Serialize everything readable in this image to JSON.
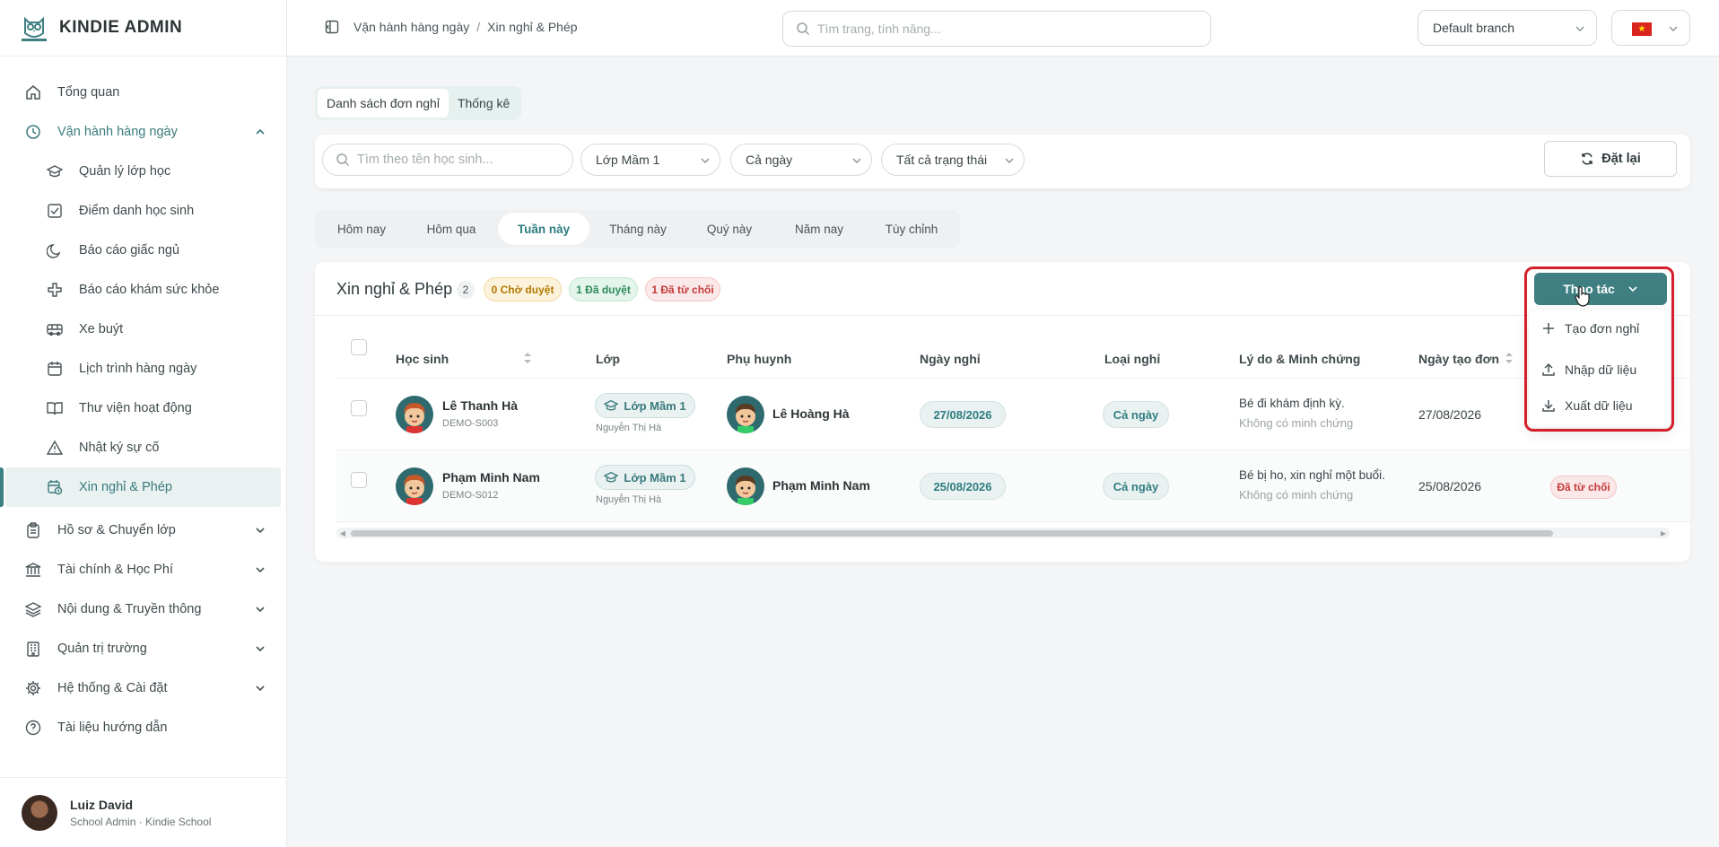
{
  "brand": {
    "name": "KINDIE ADMIN"
  },
  "sidebar": {
    "items": [
      {
        "label": "Tổng quan"
      },
      {
        "label": "Vận hành hàng ngày"
      },
      {
        "label": "Quản lý lớp học"
      },
      {
        "label": "Điểm danh học sinh"
      },
      {
        "label": "Báo cáo giấc ngủ"
      },
      {
        "label": "Báo cáo khám sức khỏe"
      },
      {
        "label": "Xe buýt"
      },
      {
        "label": "Lịch trình hàng ngày"
      },
      {
        "label": "Thư viện hoạt động"
      },
      {
        "label": "Nhật ký sự cố"
      },
      {
        "label": "Xin nghỉ & Phép"
      },
      {
        "label": "Hồ sơ & Chuyển lớp"
      },
      {
        "label": "Tài chính & Học Phí"
      },
      {
        "label": "Nội dung & Truyền thông"
      },
      {
        "label": "Quản trị trường"
      },
      {
        "label": "Hệ thống & Cài đặt"
      },
      {
        "label": "Tài liệu hướng dẫn"
      }
    ]
  },
  "user": {
    "name": "Luiz David",
    "role": "School Admin · Kindie School"
  },
  "topbar": {
    "breadcrumb": [
      "Vận hành hàng ngày",
      "/",
      "Xin nghỉ & Phép"
    ],
    "search_placeholder": "Tìm trang, tính năng...",
    "branch": "Default branch",
    "flag_star": "★"
  },
  "tabs": [
    "Danh sách đơn nghỉ",
    "Thống kê"
  ],
  "filters": {
    "search_placeholder": "Tìm theo tên học sinh...",
    "class": "Lớp Mầm 1",
    "day": "Cả ngày",
    "status": "Tất cả trạng thái",
    "reset": "Đặt lại"
  },
  "periods": [
    "Hôm nay",
    "Hôm qua",
    "Tuần này",
    "Tháng này",
    "Quý này",
    "Năm nay",
    "Tùy chỉnh"
  ],
  "card": {
    "title": "Xin nghỉ & Phép",
    "count": "2",
    "pending": "0 Chờ duyệt",
    "approved": "1 Đã duyệt",
    "rejected": "1 Đã từ chối"
  },
  "table": {
    "headers": [
      "Học sinh",
      "Lớp",
      "Phụ huynh",
      "Ngày nghỉ",
      "Loại nghỉ",
      "Lý do & Minh chứng",
      "Ngày tạo đơn"
    ],
    "rows": [
      {
        "student": "Lê Thanh Hà",
        "code": "DEMO-S003",
        "class": "Lớp Mầm 1",
        "teacher": "Nguyễn Thị Hà",
        "parent": "Lê Hoàng Hà",
        "date": "27/08/2026",
        "type": "Cả ngày",
        "reason": "Bé đi khám định kỳ.",
        "proof": "Không có minh chứng",
        "created": "27/08/2026",
        "status": ""
      },
      {
        "student": "Phạm Minh Nam",
        "code": "DEMO-S012",
        "class": "Lớp Mầm 1",
        "teacher": "Nguyễn Thị Hà",
        "parent": "Phạm Minh Nam",
        "date": "25/08/2026",
        "type": "Cả ngày",
        "reason": "Bé bị ho, xin nghỉ một buổi.",
        "proof": "Không có minh chứng",
        "created": "25/08/2026",
        "status": "Đã từ chối"
      }
    ]
  },
  "actions": {
    "button": "Thao tác",
    "menu": [
      "Tạo đơn nghỉ",
      "Nhập dữ liệu",
      "Xuất dữ liệu"
    ]
  },
  "colors": {
    "accent": "#3f7f82",
    "highlight": "#d4202a"
  }
}
